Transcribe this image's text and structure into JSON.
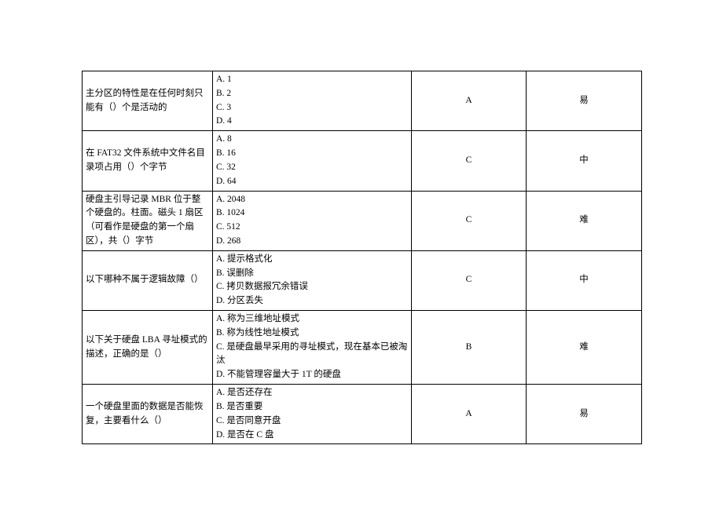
{
  "rows": [
    {
      "question": "主分区的特性是在任何时刻只能有（）个是活动的",
      "options": [
        "A. 1",
        "B. 2",
        "C. 3",
        "D. 4"
      ],
      "answer": "A",
      "difficulty": "易"
    },
    {
      "question": "在 FAT32 文件系统中文件名目录项占用（）个字节",
      "options": [
        "A. 8",
        "B. 16",
        "C. 32",
        "D. 64"
      ],
      "answer": "C",
      "difficulty": "中"
    },
    {
      "question": "硬盘主引导记录 MBR 位于整个硬盘的。柱面。磁头 1 扇区（可看作是硬盘的第一个扇区），共（）字节",
      "options": [
        "A. 2048",
        "B. 1024",
        "C. 512",
        "D. 268"
      ],
      "answer": "C",
      "difficulty": "难"
    },
    {
      "question": "以下哪种不属于逻辑故障（）",
      "options": [
        "A. 提示格式化",
        "B. 误删除",
        "C. 拷贝数据报冗余错误",
        "D. 分区丢失"
      ],
      "answer": "C",
      "difficulty": "中"
    },
    {
      "question": "以下关于硬盘 LBA 寻址模式的描述，正确的是（）",
      "options": [
        "A. 称为三维地址模式",
        "B. 称为线性地址模式",
        "C. 是硬盘最早采用的寻址模式，现在基本已被淘汰",
        "D. 不能管理容量大于 1T 的硬盘"
      ],
      "answer": "B",
      "difficulty": "难"
    },
    {
      "question": "一个硬盘里面的数据是否能恢复，主要看什么（）",
      "options": [
        "A. 是否还存在",
        "B. 是否重要",
        "C. 是否同意开盘",
        "D. 是否在 C 盘"
      ],
      "answer": "A",
      "difficulty": "易"
    }
  ]
}
